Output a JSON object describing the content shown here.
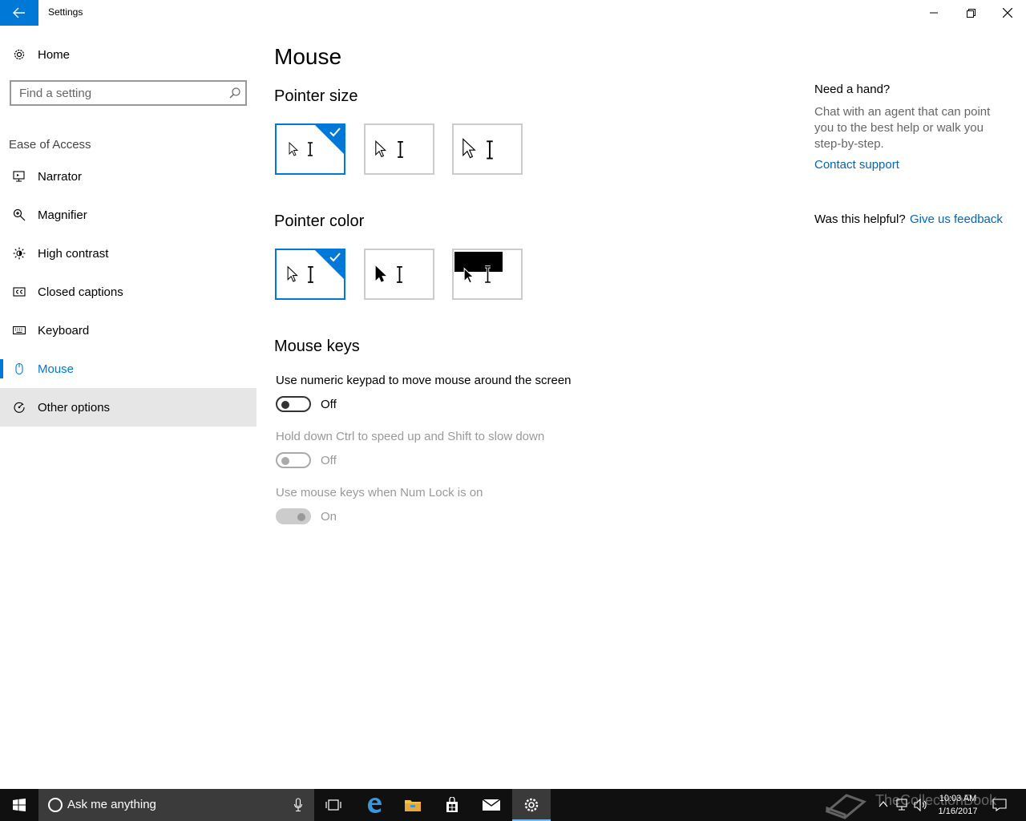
{
  "window": {
    "title": "Settings"
  },
  "sidebar": {
    "home_label": "Home",
    "search_placeholder": "Find a setting",
    "group_label": "Ease of Access",
    "items": [
      {
        "label": "Narrator",
        "icon": "narrator-icon"
      },
      {
        "label": "Magnifier",
        "icon": "magnifier-icon"
      },
      {
        "label": "High contrast",
        "icon": "high-contrast-icon"
      },
      {
        "label": "Closed captions",
        "icon": "closed-captions-icon"
      },
      {
        "label": "Keyboard",
        "icon": "keyboard-icon"
      },
      {
        "label": "Mouse",
        "icon": "mouse-icon",
        "active": true
      },
      {
        "label": "Other options",
        "icon": "other-options-icon",
        "hover": true
      }
    ]
  },
  "main": {
    "title": "Mouse",
    "pointer_size": {
      "title": "Pointer size",
      "options": [
        "small",
        "medium",
        "large"
      ],
      "selected": 0
    },
    "pointer_color": {
      "title": "Pointer color",
      "options": [
        "white",
        "black",
        "inverted"
      ],
      "selected": 0
    },
    "mouse_keys": {
      "title": "Mouse keys",
      "settings": [
        {
          "label": "Use numeric keypad to move mouse around the screen",
          "state": "Off",
          "enabled": true
        },
        {
          "label": "Hold down Ctrl to speed up and Shift to slow down",
          "state": "Off",
          "enabled": false
        },
        {
          "label": "Use mouse keys when Num Lock is on",
          "state": "On",
          "enabled": false
        }
      ]
    }
  },
  "help": {
    "title": "Need a hand?",
    "body": "Chat with an agent that can point you to the best help or walk you step-by-step.",
    "link": "Contact support",
    "helpful_label": "Was this helpful?",
    "feedback_link": "Give us feedback"
  },
  "taskbar": {
    "search_text": "Ask me anything",
    "time": "10:03 AM",
    "date": "1/16/2017",
    "watermark": "TheCollectionBook"
  },
  "colors": {
    "accent": "#0078d7",
    "link": "#0067b8",
    "taskbar": "#101010"
  }
}
